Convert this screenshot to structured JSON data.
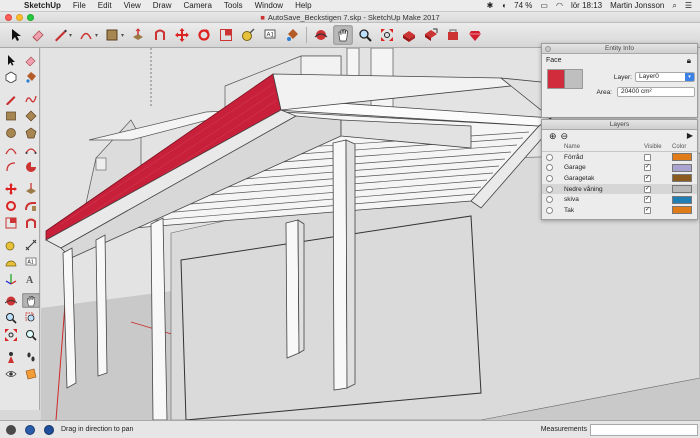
{
  "menubar": {
    "app": "SketchUp",
    "items": [
      "File",
      "Edit",
      "View",
      "Draw",
      "Camera",
      "Tools",
      "Window",
      "Help"
    ],
    "battery": "74 %",
    "clock": "lör 18:13",
    "user": "Martin Jonsson"
  },
  "window": {
    "title": "AutoSave_Beckstigen 7.skp - SketchUp Make 2017"
  },
  "toolbar": {
    "tools": [
      "select",
      "eraser",
      "line",
      "arc",
      "shape",
      "push-pull",
      "offset",
      "move",
      "rotate",
      "scale",
      "tape-measure",
      "text",
      "paint-bucket",
      "orbit",
      "pan",
      "zoom",
      "zoom-extents",
      "3d-warehouse",
      "extension-warehouse",
      "layout",
      "ruby-console"
    ],
    "active_tool": "pan"
  },
  "palette": {
    "active_tool": "pan"
  },
  "entity_info": {
    "header": "Entity Info",
    "type": "Face",
    "layer_label": "Layer:",
    "layer_value": "Layer0",
    "area_label": "Area:",
    "area_value": "20400 cm²",
    "colors": {
      "front": "#d12c3c",
      "back": "#bfbfbf"
    }
  },
  "layers": {
    "header": "Layers",
    "add_label": "⊕",
    "remove_label": "⊖",
    "columns": {
      "name": "Name",
      "visible": "Visible",
      "color": "Color"
    },
    "rows": [
      {
        "name": "Förråd",
        "visible": false,
        "color": "#e07b1a"
      },
      {
        "name": "Garage",
        "visible": true,
        "color": "#a9a3cf"
      },
      {
        "name": "Garagetak",
        "visible": true,
        "color": "#8a5a1e"
      },
      {
        "name": "Nedre våning",
        "visible": true,
        "color": "#b9b9b9",
        "selected": true
      },
      {
        "name": "skiva",
        "visible": true,
        "color": "#1f7fb5"
      },
      {
        "name": "Tak",
        "visible": true,
        "color": "#e07b1a"
      }
    ]
  },
  "statusbar": {
    "hint": "Drag in direction to pan",
    "measurements_label": "Measurements"
  }
}
